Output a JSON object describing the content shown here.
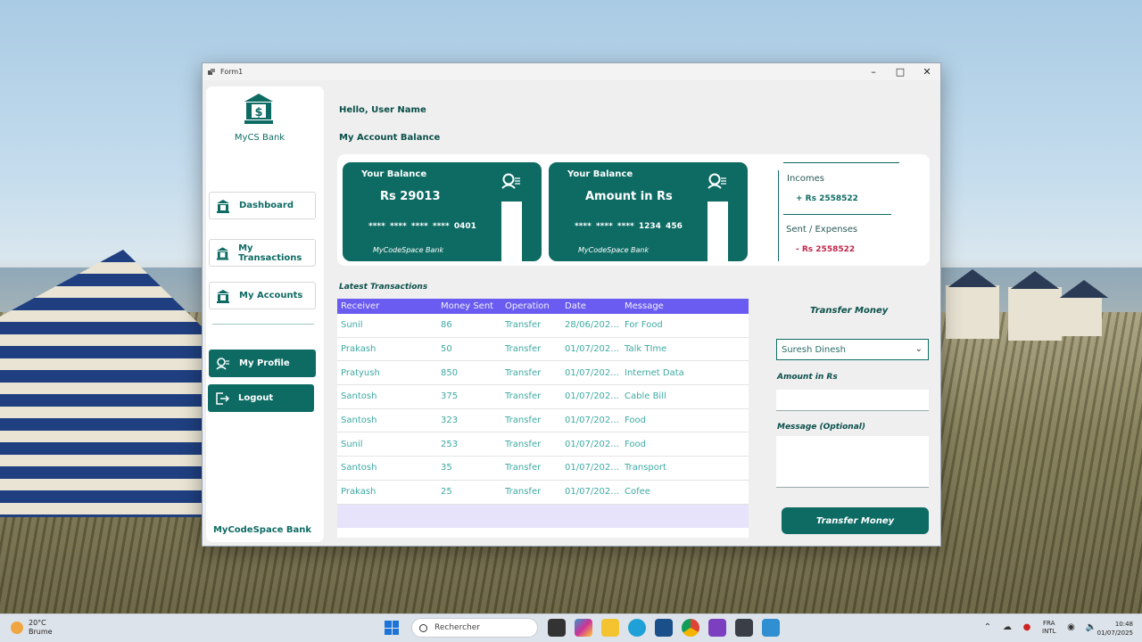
{
  "window": {
    "title": "Form1"
  },
  "sidebar": {
    "bank_name": "MyCS Bank",
    "items": [
      {
        "label": "Dashboard",
        "icon": "bank-icon"
      },
      {
        "label": "My Transactions",
        "icon": "bank-icon"
      },
      {
        "label": "My Accounts",
        "icon": "bank-icon"
      },
      {
        "label": "My Profile",
        "icon": "user-icon"
      },
      {
        "label": "Logout",
        "icon": "logout-icon"
      }
    ],
    "footer": "MyCodeSpace Bank"
  },
  "header": {
    "greeting": "Hello, User Name",
    "balance_title": "My Account Balance"
  },
  "cards": [
    {
      "title": "Your Balance",
      "amount": "Rs  29013",
      "number": "**** **** **** **** 0401",
      "bank": "MyCodeSpace Bank"
    },
    {
      "title": "Your Balance",
      "amount": "Amount in Rs",
      "number": "****   ****   ****   1234   456",
      "bank": "MyCodeSpace Bank"
    }
  ],
  "summary": {
    "incomes_label": "Incomes",
    "incomes_value": "+ Rs 2558522",
    "expenses_label": "Sent / Expenses",
    "expenses_value": "- Rs 2558522"
  },
  "transactions": {
    "title": "Latest Transactions",
    "columns": [
      "Receiver",
      "Money Sent",
      "Operation",
      "Date",
      "Message"
    ],
    "rows": [
      [
        "Sunil",
        "86",
        "Transfer",
        "28/06/202...",
        "For Food"
      ],
      [
        "Prakash",
        "50",
        "Transfer",
        "01/07/202...",
        "Talk TIme"
      ],
      [
        "Pratyush",
        "850",
        "Transfer",
        "01/07/202...",
        "Internet Data"
      ],
      [
        "Santosh",
        "375",
        "Transfer",
        "01/07/202...",
        "Cable Bill"
      ],
      [
        "Santosh",
        "323",
        "Transfer",
        "01/07/202...",
        "Food"
      ],
      [
        "Sunil",
        "253",
        "Transfer",
        "01/07/202...",
        "Food"
      ],
      [
        "Santosh",
        "35",
        "Transfer",
        "01/07/202...",
        "Transport"
      ],
      [
        "Prakash",
        "25",
        "Transfer",
        "01/07/202...",
        "Cofee"
      ]
    ]
  },
  "transfer": {
    "title": "Transfer Money",
    "recipient": "Suresh Dinesh",
    "amount_label": "Amount in Rs",
    "amount_value": "",
    "message_label": "Message (Optional)",
    "message_value": "",
    "button": "Transfer Money"
  },
  "taskbar": {
    "temp": "20°C",
    "weather": "Brume",
    "search_placeholder": "Rechercher",
    "lang_top": "FRA",
    "lang_bottom": "INTL",
    "time": "10:48",
    "date": "01/07/2025"
  },
  "colors": {
    "accent": "#0e6b64",
    "grid_header": "#6a5cf0",
    "expense": "#c0264a"
  }
}
